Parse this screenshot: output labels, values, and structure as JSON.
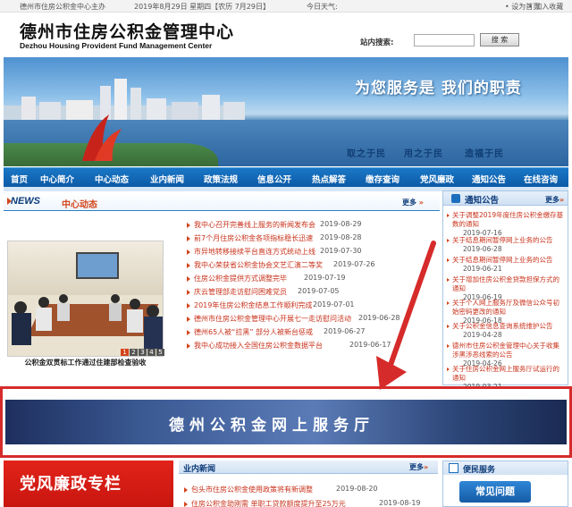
{
  "topbar": {
    "sponsor": "德州市住房公积金中心主办",
    "date": "2019年8月29日 星期四【农历 7月29日】",
    "weather_label": "今日天气:",
    "set_home": "• 设为首页",
    "add_favorite": "• 加入收藏"
  },
  "header": {
    "logo_cn": "德州市住房公积金管理中心",
    "logo_en": "Dezhou Housing Provident Fund Management Center",
    "search_label": "站内搜索:",
    "search_value": "",
    "search_button": "搜 索"
  },
  "banner": {
    "slogan": "为您服务是 我们的职责",
    "motto": [
      "取之于民",
      "用之于民",
      "造福于民"
    ],
    "colors": {
      "sky": "#4e91d0",
      "water": "#2c6aa8"
    }
  },
  "nav": {
    "items": [
      "首页",
      "中心简介",
      "中心动态",
      "业内新闻",
      "政策法规",
      "信息公开",
      "热点解答",
      "缴存查询",
      "党风廉政",
      "通知公告",
      "在线咨询"
    ]
  },
  "center_news": {
    "title_en": "NEWS",
    "title_cn": "中心动态",
    "more": "更多",
    "photo_caption": "公积金双贯标工作通过住建部检查验收",
    "pager": [
      "1",
      "2",
      "3",
      "4",
      "5"
    ],
    "items": [
      {
        "title": "我中心召开完善线上服务的新闻发布会",
        "date": "2019-08-29"
      },
      {
        "title": "前7个月住房公积金各项指标稳长迅速",
        "date": "2019-08-28"
      },
      {
        "title": "市异地转移接续平台直连方式统动上线",
        "date": "2019-07-30"
      },
      {
        "title": "我中心荣获省公积金协会文艺汇演二等奖",
        "date": "2019-07-26"
      },
      {
        "title": "住房公积金提供方式调整完毕",
        "date": "2019-07-19"
      },
      {
        "title": "庆云管理部走访慰问困难党员",
        "date": "2019-07-05"
      },
      {
        "title": "2019年住房公积金结息工作顺利完成",
        "date": "2019-07-01"
      },
      {
        "title": "德州市住房公积金管理中心开展七一走访慰问活动",
        "date": "2019-06-28"
      },
      {
        "title": "德州65人被“拉黑” 部分人被新台惩戒",
        "date": "2019-06-27"
      },
      {
        "title": "我中心成功接入全国住房公积金数据平台",
        "date": "2019-06-17"
      }
    ]
  },
  "notices": {
    "title": "通知公告",
    "more": "更多",
    "items": [
      {
        "title": "关于调整2019年度住房公积金缴存基数的通知",
        "date": "2019-07-16"
      },
      {
        "title": "关于结息期间暂停网上业务的公告",
        "date": "2019-06-28"
      },
      {
        "title": "关于结息期间暂停网上业务的公告",
        "date": "2019-06-21"
      },
      {
        "title": "关于增加住房公积金贷款担保方式的通知",
        "date": "2019-06-19"
      },
      {
        "title": "关于个人网上服务厅及微信公众号初始密码更改的通知",
        "date": "2019-06-18"
      },
      {
        "title": "关于公积金信息查询系统维护公告",
        "date": "2019-04-28"
      },
      {
        "title": "德州市住房公积金管理中心关于收集涉黑涉恶线索的公告",
        "date": "2019-04-26"
      },
      {
        "title": "关于住房公积金网上服务厅试运行的通知",
        "date": "2019-03-21"
      }
    ]
  },
  "service_hall": {
    "text": "德州公积金网上服务厅"
  },
  "party": {
    "text": "党风廉政专栏"
  },
  "industry_news": {
    "title": "业内新闻",
    "more": "更多",
    "items": [
      {
        "title": "包头市住房公积金使用政策将有新调整",
        "date": "2019-08-20"
      },
      {
        "title": "住房公积金助刚需 单职工贷款额度提升至25万元",
        "date": "2019-08-19"
      }
    ]
  },
  "convenience": {
    "title": "便民服务",
    "button": "常见问题"
  },
  "colors": {
    "nav_blue": "#0c5aa6",
    "accent_red": "#d3451b",
    "frame_red": "#d62b2b",
    "party_red": "#e2231a"
  }
}
